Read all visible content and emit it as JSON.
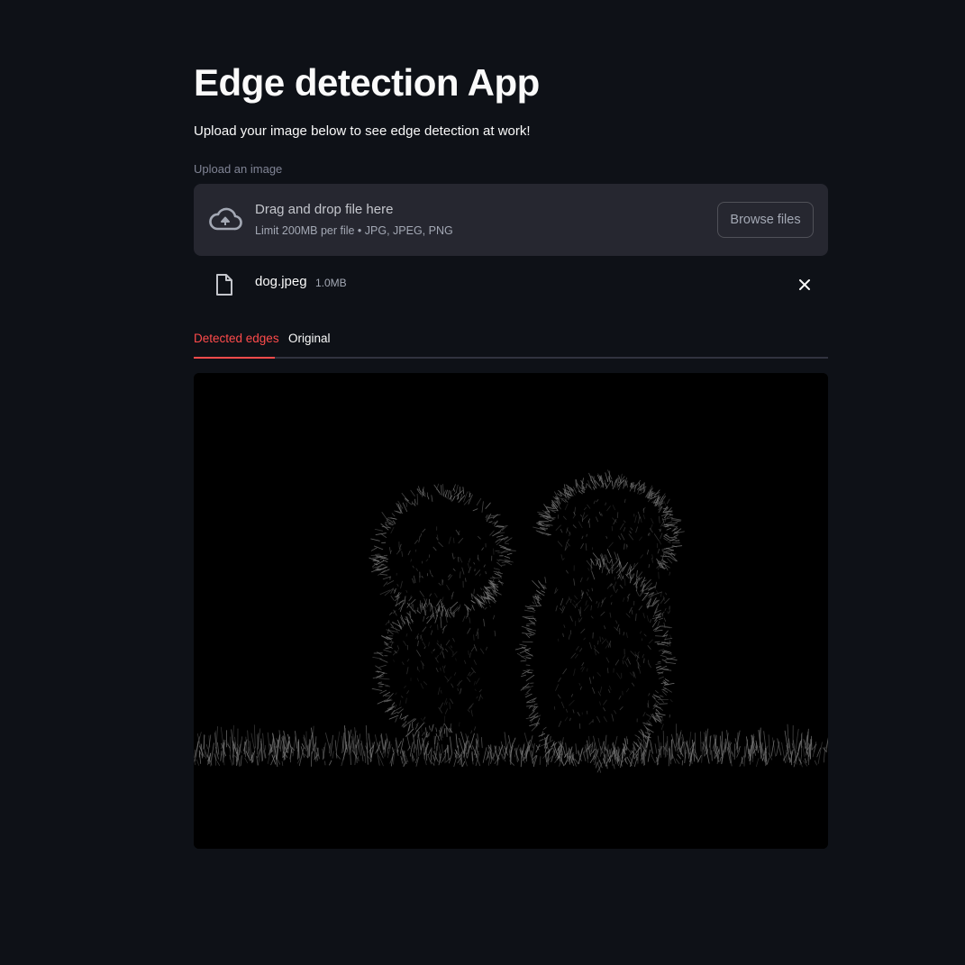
{
  "app": {
    "title": "Edge detection App",
    "subtitle": "Upload your image below to see edge detection at work!"
  },
  "uploader": {
    "label": "Upload an image",
    "drop_text": "Drag and drop file here",
    "limit_text": "Limit 200MB per file • JPG, JPEG, PNG",
    "browse_label": "Browse files",
    "icon": "cloud-upload-icon"
  },
  "file": {
    "name": "dog.jpeg",
    "size": "1.0MB",
    "icon": "file-icon",
    "remove_icon": "close-icon"
  },
  "tabs": [
    {
      "label": "Detected edges",
      "active": true
    },
    {
      "label": "Original",
      "active": false
    }
  ],
  "colors": {
    "background": "#0e1117",
    "accent": "#ff4b4b",
    "panel": "#262730"
  }
}
